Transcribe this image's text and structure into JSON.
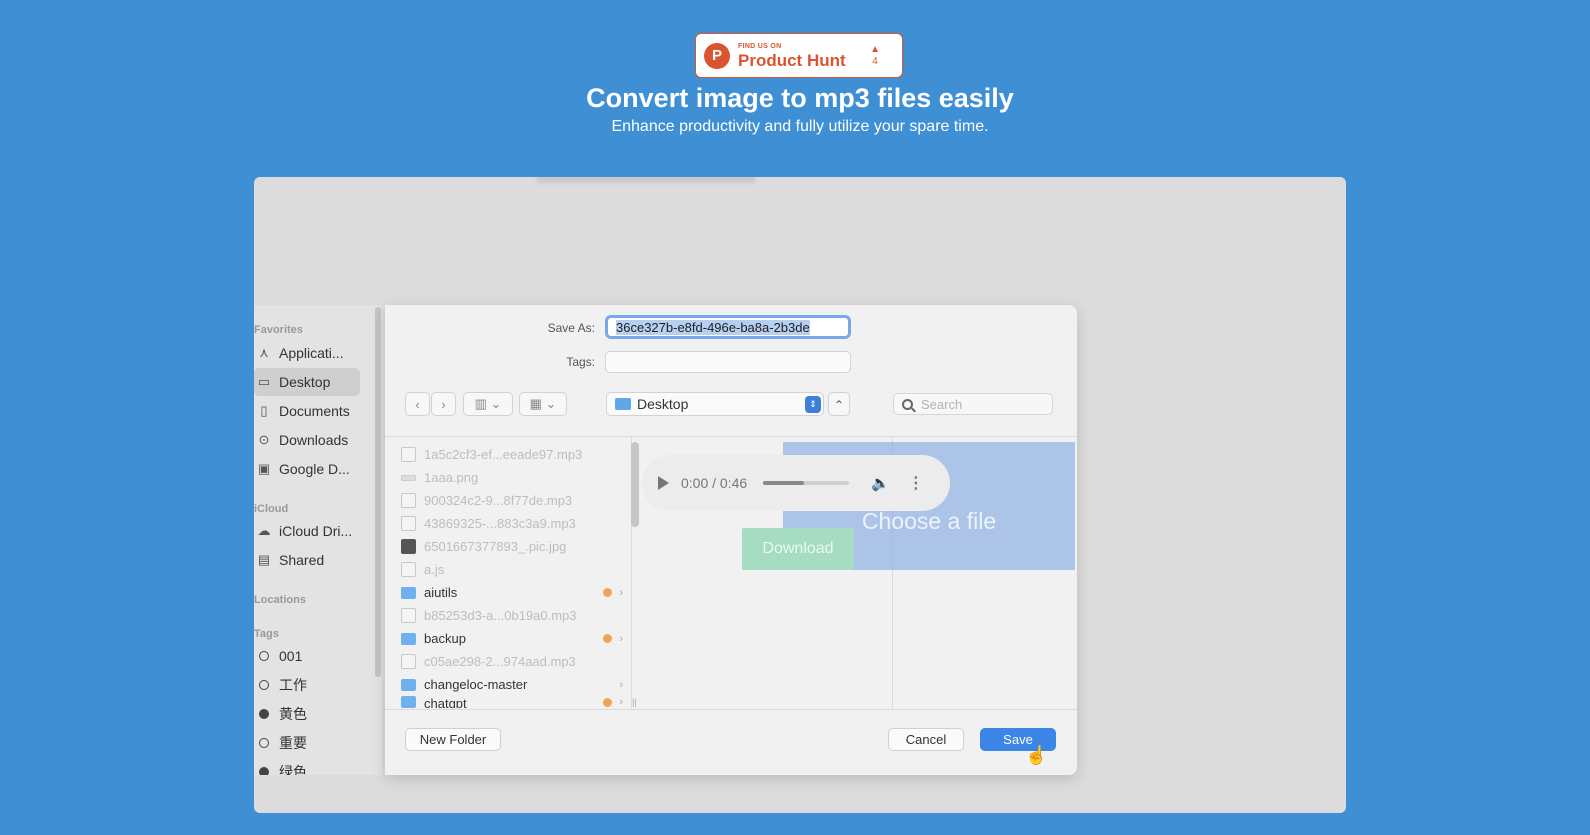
{
  "product_hunt": {
    "find_us": "FIND US ON",
    "name": "Product Hunt",
    "logo_letter": "P",
    "vote_arrow": "▲",
    "votes": "4"
  },
  "hero": {
    "title": "Convert image to mp3 files easily",
    "subtitle": "Enhance productivity and fully utilize your spare time."
  },
  "sidebar": {
    "favorites_label": "Favorites",
    "favorites": [
      {
        "label": "Applicati...",
        "icon": "applications-icon"
      },
      {
        "label": "Desktop",
        "icon": "desktop-icon"
      },
      {
        "label": "Documents",
        "icon": "documents-icon"
      },
      {
        "label": "Downloads",
        "icon": "downloads-icon"
      },
      {
        "label": "Google D...",
        "icon": "google-drive-icon"
      }
    ],
    "icloud_label": "iCloud",
    "icloud": [
      {
        "label": "iCloud Dri...",
        "icon": "cloud-icon"
      },
      {
        "label": "Shared",
        "icon": "shared-folder-icon"
      }
    ],
    "locations_label": "Locations",
    "tags_label": "Tags",
    "tags": [
      {
        "label": "001"
      },
      {
        "label": "工作"
      },
      {
        "label": "黄色"
      },
      {
        "label": "重要"
      },
      {
        "label": "绿色"
      }
    ]
  },
  "dialog": {
    "save_as_label": "Save As:",
    "save_as_value": "36ce327b-e8fd-496e-ba8a-2b3de",
    "tags_label": "Tags:",
    "location": "Desktop",
    "search_placeholder": "Search",
    "files": [
      {
        "name": "1a5c2cf3-ef...eeade97.mp3",
        "type": "audio"
      },
      {
        "name": "1aaa.png",
        "type": "image"
      },
      {
        "name": "900324c2-9...8f77de.mp3",
        "type": "audio"
      },
      {
        "name": "43869325-...883c3a9.mp3",
        "type": "audio"
      },
      {
        "name": "6501667377893_.pic.jpg",
        "type": "photo"
      },
      {
        "name": "a.js",
        "type": "script"
      },
      {
        "name": "aiutils",
        "type": "folder",
        "tagged": true
      },
      {
        "name": "b85253d3-a...0b19a0.mp3",
        "type": "audio"
      },
      {
        "name": "backup",
        "type": "folder",
        "tagged": true
      },
      {
        "name": "c05ae298-2...974aad.mp3",
        "type": "audio"
      },
      {
        "name": "changeloc-master",
        "type": "folder",
        "tagged": false
      },
      {
        "name": "chatgpt",
        "type": "folder",
        "tagged": true
      }
    ],
    "new_folder": "New Folder",
    "cancel": "Cancel",
    "save": "Save"
  },
  "upload": {
    "label": "Choose a file"
  },
  "player": {
    "time": "0:00 / 0:46",
    "progress_fraction": 0.47
  },
  "download": {
    "label": "Download"
  },
  "colors": {
    "background": "#3e8fd3",
    "product_hunt": "#da552f",
    "save_button": "#3a85e6",
    "download_button": "#a6dcc1"
  }
}
